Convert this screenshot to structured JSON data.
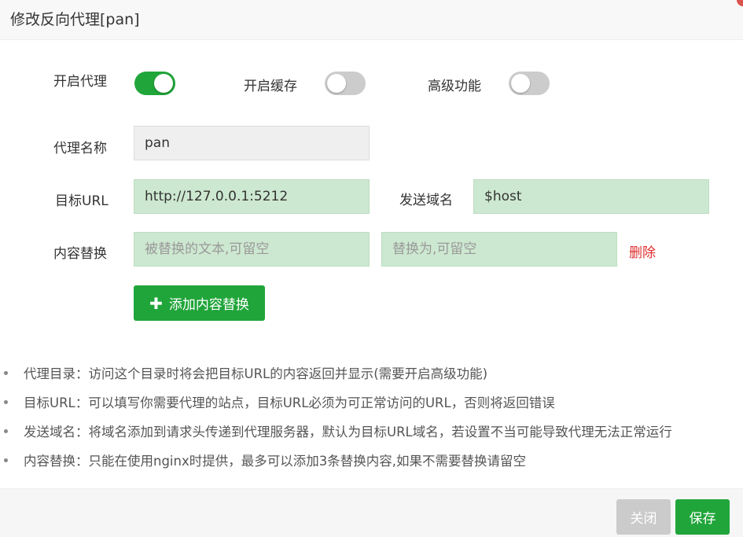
{
  "dialog": {
    "title": "修改反向代理[pan]"
  },
  "toggles": [
    {
      "label": "开启代理",
      "on": true
    },
    {
      "label": "开启缓存",
      "on": false
    },
    {
      "label": "高级功能",
      "on": false
    }
  ],
  "form": {
    "proxy_name_label": "代理名称",
    "proxy_name_value": "pan",
    "target_url_label": "目标URL",
    "target_url_value": "http://127.0.0.1:5212",
    "send_domain_label": "发送域名",
    "send_domain_value": "$host",
    "replace_label": "内容替换",
    "replace_from_placeholder": "被替换的文本,可留空",
    "replace_to_placeholder": "替换为,可留空",
    "delete_label": "删除",
    "add_replace_label": "添加内容替换"
  },
  "notes": [
    "代理目录：访问这个目录时将会把目标URL的内容返回并显示(需要开启高级功能)",
    "目标URL：可以填写你需要代理的站点，目标URL必须为可正常访问的URL，否则将返回错误",
    "发送域名：将域名添加到请求头传递到代理服务器，默认为目标URL域名，若设置不当可能导致代理无法正常运行",
    "内容替换：只能在使用nginx时提供，最多可以添加3条替换内容,如果不需要替换请留空"
  ],
  "footer": {
    "close_label": "关闭",
    "save_label": "保存"
  },
  "colors": {
    "accent": "#20a53a",
    "delete": "#e02d2d",
    "input_green": "#cde8d0"
  }
}
